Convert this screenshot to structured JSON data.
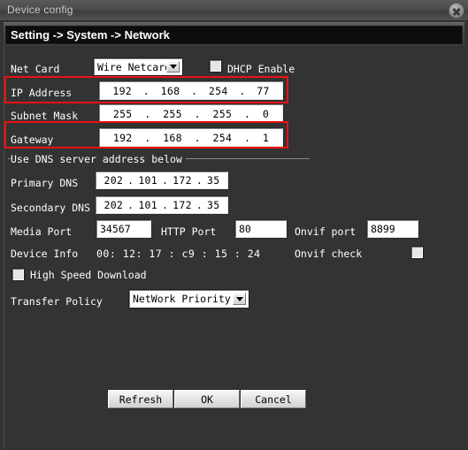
{
  "window": {
    "title": "Device config",
    "close_icon": "close-circle-icon"
  },
  "header": {
    "breadcrumb": "Setting -> System -> Network"
  },
  "colors": {
    "panel_bg": "#333333",
    "header_bg": "#0d0d0d",
    "annotation_red": "#ee1111",
    "field_bg": "#ffffff",
    "label_text": "#ffffff"
  },
  "form": {
    "net_card": {
      "label": "Net Card",
      "value": "Wire Netcard",
      "arrow_icon": "chevron-down-icon"
    },
    "dhcp": {
      "label": "DHCP Enable",
      "checked": false
    },
    "ip_address": {
      "label": "IP Address",
      "octets": [
        "192",
        "168",
        "254",
        "77"
      ],
      "highlighted": true
    },
    "subnet_mask": {
      "label": "Subnet Mask",
      "octets": [
        "255",
        "255",
        "255",
        "0"
      ],
      "highlighted": false
    },
    "gateway": {
      "label": "Gateway",
      "octets": [
        "192",
        "168",
        "254",
        "1"
      ],
      "highlighted": true
    },
    "dns_group": {
      "legend": "Use DNS server address below",
      "primary": {
        "label": "Primary DNS",
        "octets": [
          "202",
          "101",
          "172",
          "35"
        ]
      },
      "secondary": {
        "label": "Secondary DNS",
        "octets": [
          "202",
          "101",
          "172",
          "35"
        ]
      }
    },
    "media_port": {
      "label": "Media Port",
      "value": "34567"
    },
    "http_port": {
      "label": "HTTP Port",
      "value": "80"
    },
    "onvif_port": {
      "label": "Onvif port",
      "value": "8899"
    },
    "device_info": {
      "label": "Device Info",
      "value": "00: 12: 17 : c9 : 15 : 24"
    },
    "onvif_check": {
      "label": "Onvif check",
      "checked": false
    },
    "high_speed_download": {
      "label": "High Speed Download",
      "checked": false
    },
    "transfer_policy": {
      "label": "Transfer Policy",
      "value": "NetWork  Priority",
      "arrow_icon": "chevron-down-icon"
    }
  },
  "buttons": {
    "refresh": "Refresh",
    "ok": "OK",
    "cancel": "Cancel"
  },
  "dots": {
    "sep": "."
  }
}
